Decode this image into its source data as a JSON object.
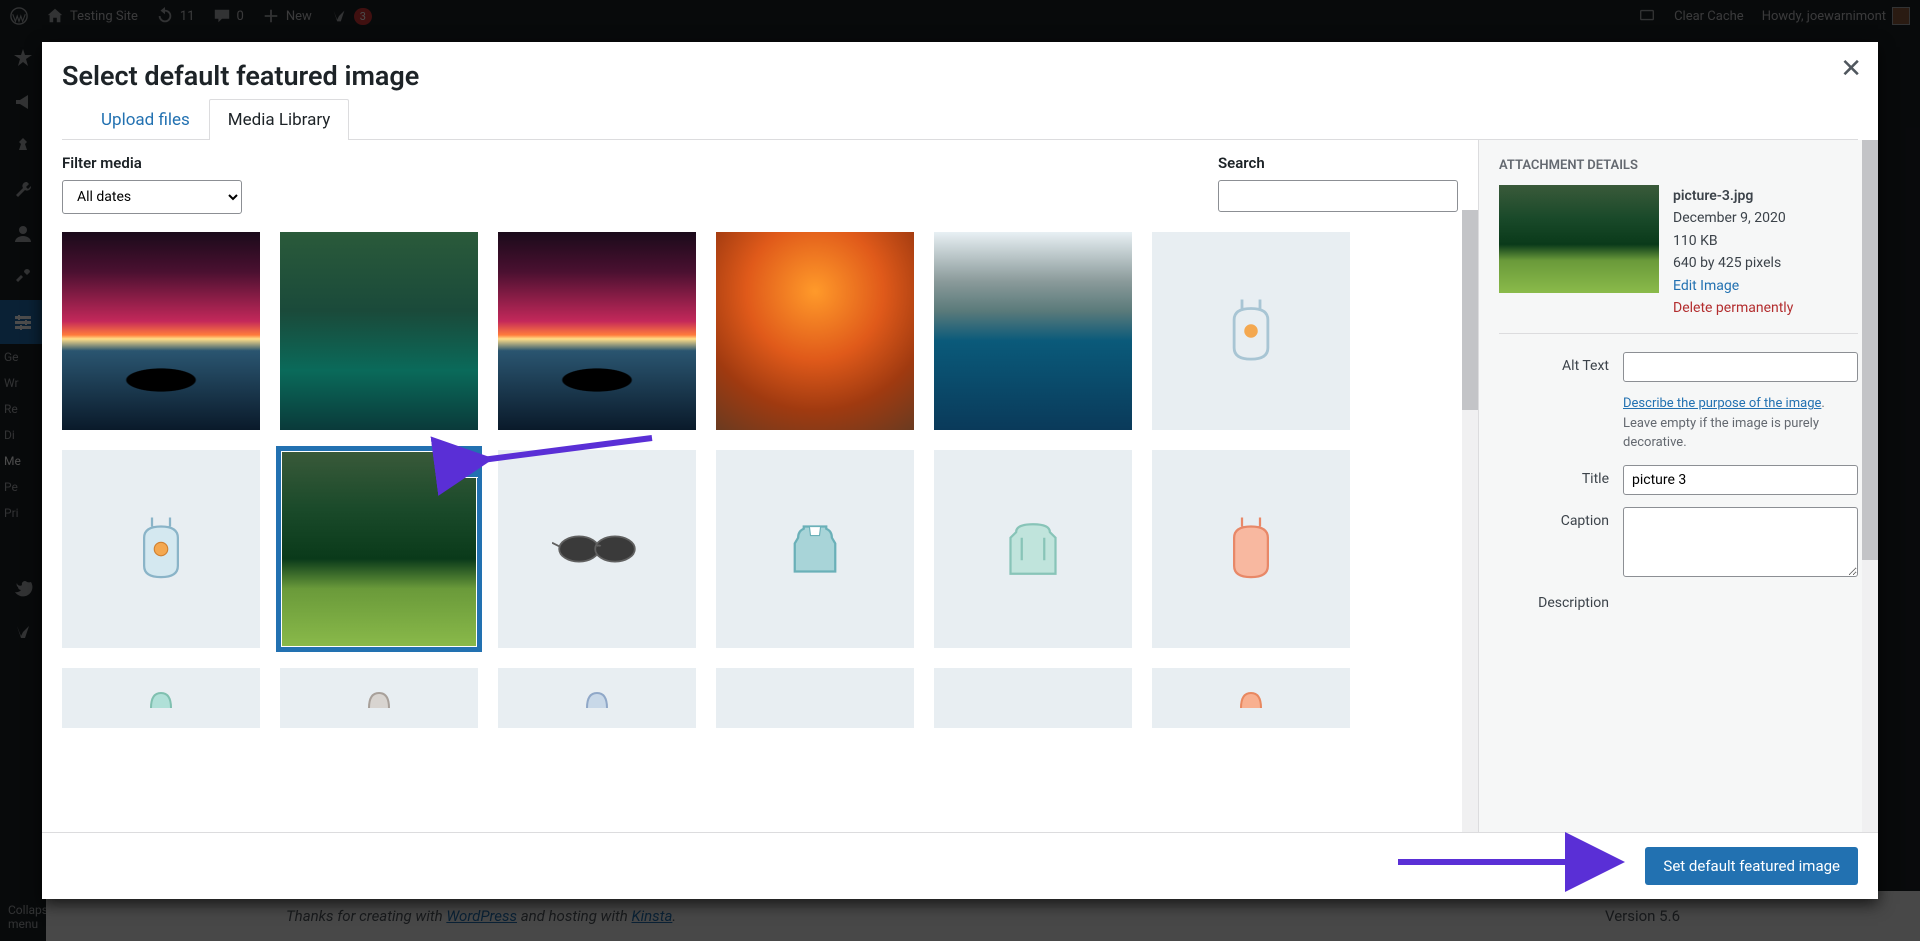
{
  "admin_bar": {
    "site_name": "Testing Site",
    "updates": "11",
    "comments": "0",
    "new_label": "New",
    "yoast_badge": "3",
    "clear_cache": "Clear Cache",
    "howdy": "Howdy, joewarnimont"
  },
  "sidebar": {
    "truncated": [
      "Ge",
      "Wr",
      "Re",
      "Di",
      "Me",
      "Pe",
      "Pri"
    ],
    "collapse": "Collapse menu"
  },
  "modal": {
    "title": "Select default featured image",
    "tabs": {
      "upload": "Upload files",
      "library": "Media Library"
    },
    "filter_label": "Filter media",
    "date_filter": "All dates",
    "search_label": "Search",
    "search_value": ""
  },
  "details": {
    "heading": "ATTACHMENT DETAILS",
    "filename": "picture-3.jpg",
    "date": "December 9, 2020",
    "size": "110 KB",
    "dimensions": "640 by 425 pixels",
    "edit_link": "Edit Image",
    "delete_link": "Delete permanently",
    "alt_label": "Alt Text",
    "alt_value": "",
    "alt_hint_link": "Describe the purpose of the image",
    "alt_hint_rest": ". Leave empty if the image is purely decorative.",
    "title_label": "Title",
    "title_value": "picture 3",
    "caption_label": "Caption",
    "caption_value": "",
    "description_label": "Description"
  },
  "footer_button": "Set default featured image",
  "wp_footer": {
    "pre": "Thanks for creating with ",
    "wp": "WordPress",
    "mid": " and hosting with ",
    "kinsta": "Kinsta",
    "post": ".",
    "version": "Version 5.6"
  }
}
